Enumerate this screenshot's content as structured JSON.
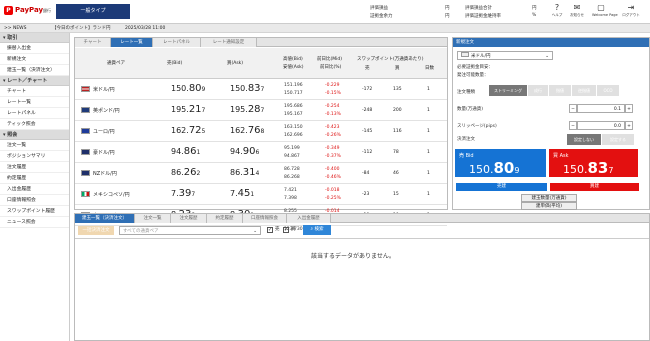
{
  "header": {
    "brand": "PayPay",
    "brand_sub": "銀行",
    "account_type": "一般タイプ",
    "labels": {
      "valuation": "評価損益",
      "margin_power": "証拠金余力",
      "valuation_total": "評価損益合計",
      "valuation_rate": "評価証拠金維持率"
    },
    "units": {
      "yen1": "円",
      "yen2": "円",
      "yen3": "円",
      "pct": "%"
    },
    "icons": [
      {
        "name": "help-icon",
        "glyph": "?",
        "label": "ヘルプ"
      },
      {
        "name": "mail-icon",
        "glyph": "✉",
        "label": "お知らせ"
      },
      {
        "name": "webpage-icon",
        "glyph": "▢",
        "label": "Welcome Page"
      },
      {
        "name": "logout-icon",
        "glyph": "⇥",
        "label": "ログアウト"
      }
    ]
  },
  "news": {
    "prefix": ">> NEWS",
    "text": "【今日のポイント】ランド円",
    "date": "2025/03/28 11:00"
  },
  "sidebar": {
    "sections": [
      {
        "title": "取引",
        "items": [
          "振替入出金",
          "新規注文",
          "建玉一覧（決済注文）"
        ]
      },
      {
        "title": "レート／チャート",
        "items": [
          "チャート",
          "レート一覧",
          "レートパネル",
          "ティック照会"
        ]
      },
      {
        "title": "照会",
        "items": [
          "注文一覧",
          "ポジションサマリ",
          "注文履歴",
          "約定履歴",
          "入出金履歴",
          "口座情報照会",
          "スワップポイント履歴",
          "ニュース照会"
        ]
      }
    ]
  },
  "rate_panel": {
    "tabs": [
      "チャート",
      "レート一覧",
      "レートパネル",
      "レート通知設定"
    ],
    "active_tab": 1,
    "columns": {
      "pair": "通貨ペア",
      "bid": "売(Bid)",
      "ask": "買(Ask)",
      "highlow": "高値(Bid)",
      "highlow2": "安値(Ask)",
      "change": "前日比(Mid)",
      "change2": "前日比(%)",
      "swap": "スワップポイント(万通貨あたり)",
      "swap_sell": "売",
      "swap_buy": "買",
      "days": "日数"
    },
    "rows": [
      {
        "pair": "米ドル/円",
        "flag": "us",
        "bid_a": "150.",
        "bid_b": "80",
        "bid_c": "9",
        "ask_a": "150.",
        "ask_b": "83",
        "ask_c": "7",
        "high": "151.196",
        "low": "150.717",
        "chg": "-0.229",
        "chgp": "-0.15%",
        "ss": "-172",
        "sb": "135",
        "d": "1"
      },
      {
        "pair": "英ポンド/円",
        "flag": "gb",
        "bid_a": "195.",
        "bid_b": "21",
        "bid_c": "7",
        "ask_a": "195.",
        "ask_b": "28",
        "ask_c": "7",
        "high": "195.686",
        "low": "195.167",
        "chg": "-0.254",
        "chgp": "-0.13%",
        "ss": "-248",
        "sb": "200",
        "d": "1"
      },
      {
        "pair": "ユーロ/円",
        "flag": "eu",
        "bid_a": "162.",
        "bid_b": "72",
        "bid_c": "5",
        "ask_a": "162.",
        "ask_b": "76",
        "ask_c": "8",
        "high": "163.150",
        "low": "162.696",
        "chg": "-0.423",
        "chgp": "-0.26%",
        "ss": "-145",
        "sb": "116",
        "d": "1"
      },
      {
        "pair": "豪ドル/円",
        "flag": "au",
        "bid_a": "94.",
        "bid_b": "86",
        "bid_c": "1",
        "ask_a": "94.",
        "ask_b": "90",
        "ask_c": "6",
        "high": "95.199",
        "low": "94.867",
        "chg": "-0.349",
        "chgp": "-0.37%",
        "ss": "-112",
        "sb": "78",
        "d": "1"
      },
      {
        "pair": "NZドル/円",
        "flag": "nz",
        "bid_a": "86.",
        "bid_b": "26",
        "bid_c": "2",
        "ask_a": "86.",
        "ask_b": "31",
        "ask_c": "4",
        "high": "86.728",
        "low": "86.268",
        "chg": "-0.400",
        "chgp": "-0.46%",
        "ss": "-84",
        "sb": "46",
        "d": "1"
      },
      {
        "pair": "メキシコペソ/円",
        "flag": "mx",
        "bid_a": "7.",
        "bid_b": "39",
        "bid_c": "7",
        "ask_a": "7.",
        "ask_b": "45",
        "ask_c": "1",
        "high": "7.421",
        "low": "7.398",
        "chg": "-0.018",
        "chgp": "-0.25%",
        "ss": "-23",
        "sb": "15",
        "d": "1"
      },
      {
        "pair": "南アフリカランド/円",
        "flag": "za",
        "bid_a": "8.",
        "bid_b": "23",
        "bid_c": "8",
        "ask_a": "8.",
        "ask_b": "30",
        "ask_c": "1",
        "high": "8.255",
        "low": "8.238",
        "chg": "-0.014",
        "chgp": "-0.17%",
        "ss": "-19",
        "sb": "10",
        "d": "1"
      }
    ],
    "partial_row": "123.730"
  },
  "order_panel": {
    "title": "新規注文",
    "pair": "米ドル/円",
    "margin_required": "必要証拠金目安：",
    "orderable_qty": "発注可能数量：",
    "order_type_label": "注文種類",
    "order_types": [
      "ストリーミング",
      "成行",
      "指値",
      "逆指値",
      "OCO"
    ],
    "qty_label": "数量(万通貨)",
    "qty_value": "0.1",
    "slippage_label": "スリッページ(pips)",
    "slippage_value": "0.0",
    "settle_label": "決済注文",
    "settle_off": "設定しない",
    "settle_on": "設定する",
    "bid_title": "売 Bid",
    "bid_a": "150.",
    "bid_b": "80",
    "bid_c": "9",
    "ask_title": "買 Ask",
    "ask_a": "150.",
    "ask_b": "83",
    "ask_c": "7",
    "sell_btn": "売建",
    "buy_btn": "買建",
    "pos_btn": "建玉数量(万通貨)",
    "avg_btn": "建単価(平均)"
  },
  "bottom_panel": {
    "tabs": [
      "建玉一覧（決済注文）",
      "注文一覧",
      "注文履歴",
      "約定履歴",
      "口座情報照会",
      "入出金履歴"
    ],
    "active_tab": 0,
    "bulk_btn": "一括決済注文",
    "select_placeholder": "すべての通貨ペア",
    "sell_label": "売",
    "buy_label": "買",
    "search_btn": "検索",
    "empty_msg": "該当するデータがありません。"
  },
  "colors": {
    "blue": "#2f6fb5",
    "bid": "#1573d4",
    "ask": "#e31010",
    "navy": "#1c3a78"
  }
}
